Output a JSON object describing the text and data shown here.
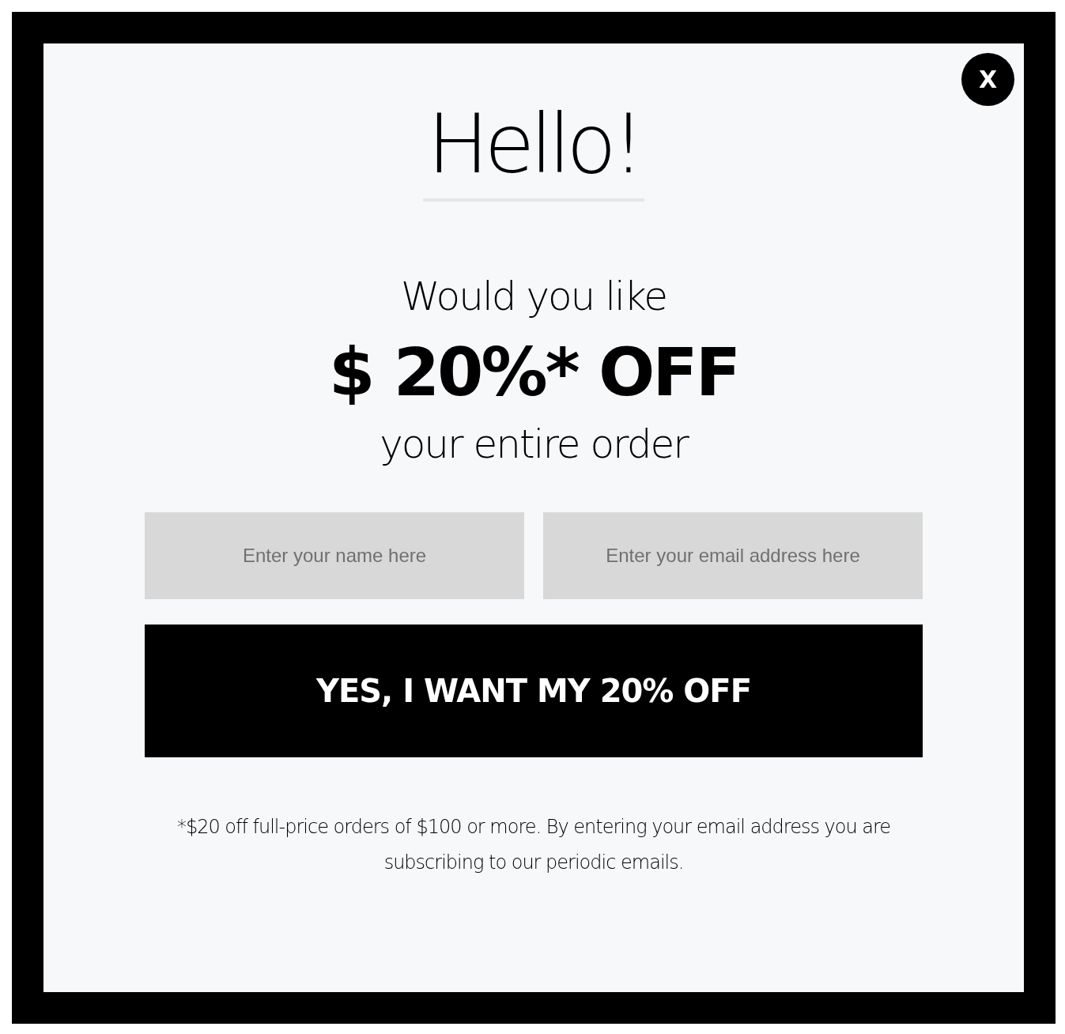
{
  "close_button": {
    "label": "X"
  },
  "title": "Hello!",
  "offer": {
    "intro": "Would you like",
    "headline": "$ 20%* OFF",
    "outro": "your entire order"
  },
  "fields": [
    {
      "placeholder": "Enter your name here"
    },
    {
      "placeholder": "Enter your email address here"
    }
  ],
  "submit_button": {
    "label": "YES, I WANT MY 20% OFF"
  },
  "disclaimer": "*$20 off full-price orders of $100 or more. By entering your email address you are subscribing to our periodic emails."
}
